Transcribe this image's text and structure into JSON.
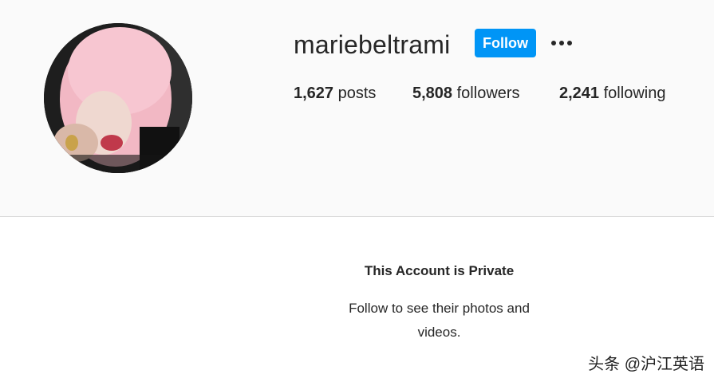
{
  "profile": {
    "username": "mariebeltrami",
    "follow_label": "Follow",
    "more_options_icon": "more-horizontal-icon"
  },
  "stats": {
    "posts": {
      "count": "1,627",
      "label": "posts"
    },
    "followers": {
      "count": "5,808",
      "label": "followers"
    },
    "following": {
      "count": "2,241",
      "label": "following"
    }
  },
  "private_notice": {
    "title": "This Account is Private",
    "message": "Follow to see their photos and videos."
  },
  "watermark": {
    "text": "头条 @沪江英语"
  },
  "colors": {
    "follow_button": "#0095f6",
    "header_background": "#fafafa",
    "divider": "#dbdbdb",
    "text": "#262626"
  }
}
